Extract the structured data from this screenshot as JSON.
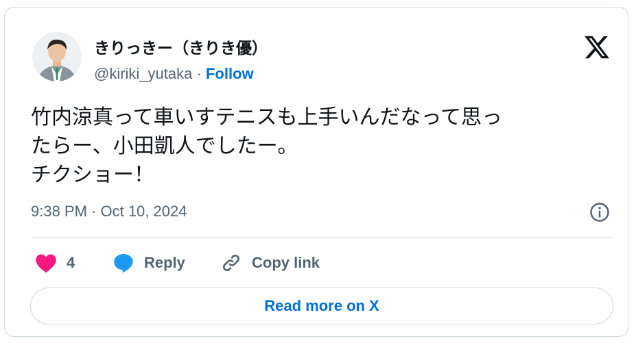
{
  "author": {
    "display_name": "きりっきー（きりき優）",
    "handle": "@kiriki_yutaka",
    "separator": "·",
    "follow_label": "Follow"
  },
  "tweet": {
    "text": "竹内涼真って車いすテニスも上手いんだなって思っ\nたらー、小田凱人でしたー。\nチクショー！",
    "timestamp": "9:38 PM · Oct 10, 2024"
  },
  "actions": {
    "like_count": "4",
    "reply_label": "Reply",
    "copy_link_label": "Copy link"
  },
  "read_more_label": "Read more on X",
  "colors": {
    "text": "#0f1419",
    "muted": "#536471",
    "link": "#006fd6",
    "like": "#f91880",
    "reply": "#1d9bf0",
    "border": "#cfd9de"
  },
  "icons": [
    "x-logo-icon",
    "info-icon",
    "heart-icon",
    "reply-bubble-icon",
    "link-icon"
  ]
}
